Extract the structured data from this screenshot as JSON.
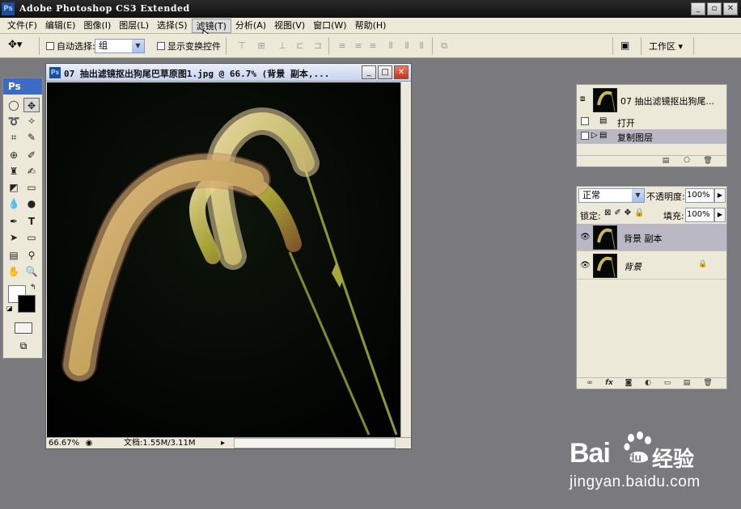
{
  "app": {
    "title": "Adobe Photoshop CS3 Extended",
    "icon": "Ps"
  },
  "menubar": {
    "items": [
      "文件(F)",
      "编辑(E)",
      "图像(I)",
      "图层(L)",
      "选择(S)",
      "滤镜(T)",
      "分析(A)",
      "视图(V)",
      "窗口(W)",
      "帮助(H)"
    ],
    "active_index": 5
  },
  "options_bar": {
    "auto_select_label": "自动选择:",
    "auto_select_value": "组",
    "show_transform_label": "显示变换控件",
    "workspace_label": "工作区 ▾"
  },
  "toolbox": {
    "header": "Ps"
  },
  "document": {
    "title": "07 抽出滤镜抠出狗尾巴草原图1.jpg @ 66.7% (背景 副本,...",
    "zoom": "66.67%",
    "doc_size": "文档:1.55M/3.11M"
  },
  "history_panel": {
    "snapshot_label": "07 抽出滤镜抠出狗尾...",
    "items": [
      {
        "label": "打开"
      },
      {
        "label": "复制图层",
        "current": true
      }
    ]
  },
  "layers_panel": {
    "blend_mode": "正常",
    "opacity_label": "不透明度:",
    "opacity_value": "100%",
    "lock_label": "锁定:",
    "fill_label": "填充:",
    "fill_value": "100%",
    "layers": [
      {
        "name": "背景 副本",
        "selected": true,
        "locked": false
      },
      {
        "name": "背景",
        "selected": false,
        "locked": true
      }
    ]
  },
  "watermark": {
    "logo": "Bai",
    "logo_suffix": "经验",
    "du": "du",
    "url": "jingyan.baidu.com"
  },
  "colors": {
    "accent": "#3b6cc4",
    "panel": "#ece9d8",
    "workspace": "#7a797e"
  }
}
